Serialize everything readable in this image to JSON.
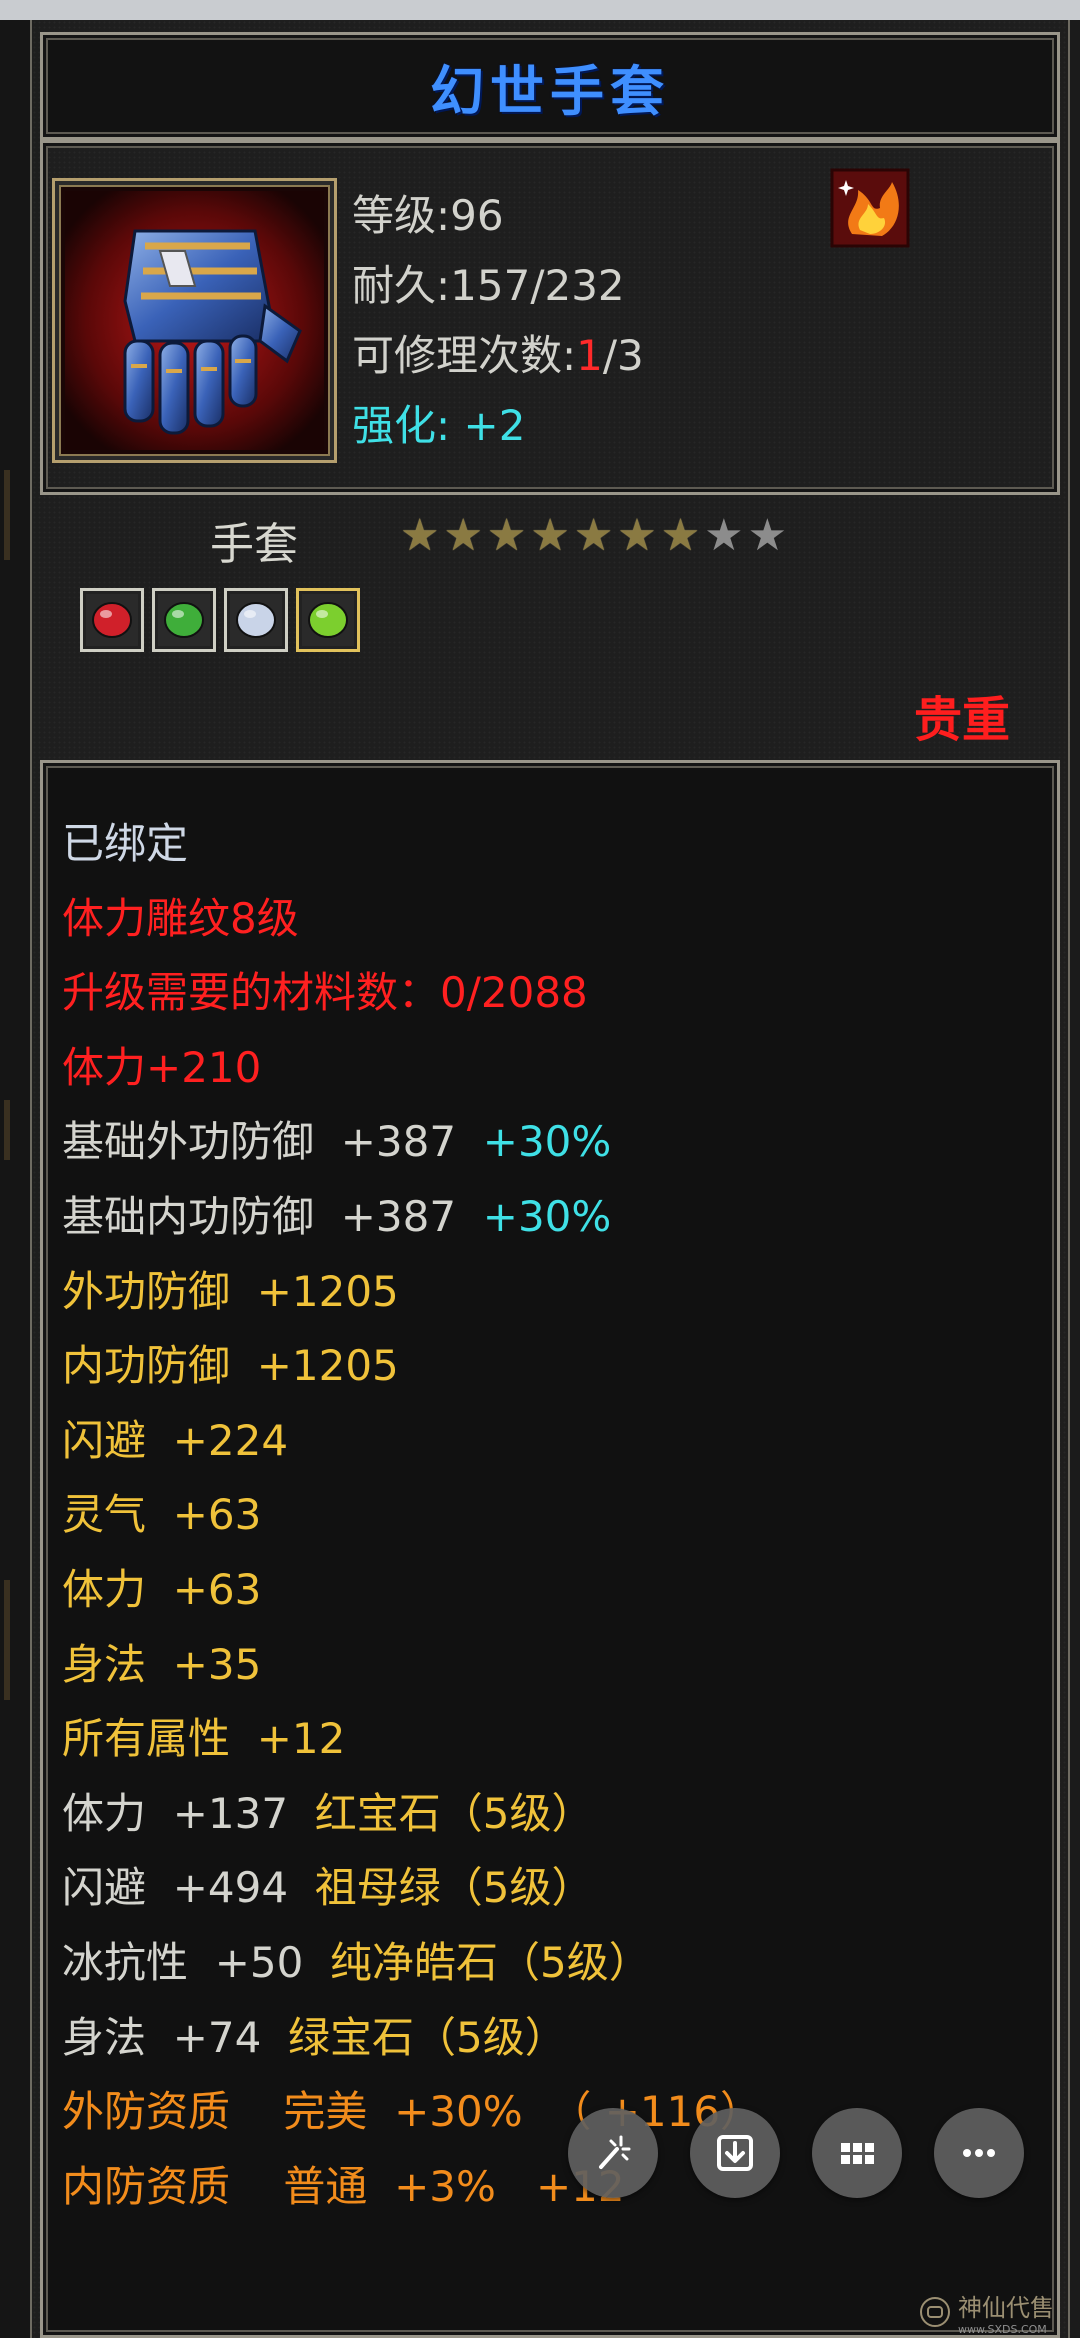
{
  "item": {
    "title": "幻世手套",
    "level_label": "等级",
    "level_value": "96",
    "durability_label": "耐久",
    "durability_value": "157/232",
    "repair_label": "可修理次数",
    "repair_used": "1",
    "repair_total": "/3",
    "enhance_label": "强化",
    "enhance_value": "+2",
    "type": "手套",
    "stars_total": 9,
    "stars_filled": 7,
    "rarity": "贵重"
  },
  "attributes": [
    {
      "segments": [
        {
          "text": "已绑定",
          "color": "white"
        }
      ]
    },
    {
      "segments": [
        {
          "text": "体力雕纹8级",
          "color": "red"
        }
      ]
    },
    {
      "segments": [
        {
          "text": "升级需要的材料数：0/2088",
          "color": "red"
        }
      ]
    },
    {
      "segments": [
        {
          "text": "体力+210",
          "color": "red"
        }
      ]
    },
    {
      "segments": [
        {
          "text": "基础外功防御  +387  ",
          "color": "grey"
        },
        {
          "text": "+30%",
          "color": "cyan"
        }
      ]
    },
    {
      "segments": [
        {
          "text": "基础内功防御  +387  ",
          "color": "grey"
        },
        {
          "text": "+30%",
          "color": "cyan"
        }
      ]
    },
    {
      "segments": [
        {
          "text": "外功防御  +1205",
          "color": "yellow"
        }
      ]
    },
    {
      "segments": [
        {
          "text": "内功防御  +1205",
          "color": "yellow"
        }
      ]
    },
    {
      "segments": [
        {
          "text": "闪避  +224",
          "color": "yellow"
        }
      ]
    },
    {
      "segments": [
        {
          "text": "灵气  +63",
          "color": "yellow"
        }
      ]
    },
    {
      "segments": [
        {
          "text": "体力  +63",
          "color": "yellow"
        }
      ]
    },
    {
      "segments": [
        {
          "text": "身法  +35",
          "color": "yellow"
        }
      ]
    },
    {
      "segments": [
        {
          "text": "所有属性  +12",
          "color": "yellow"
        }
      ]
    },
    {
      "segments": [
        {
          "text": "体力  +137  ",
          "color": "grey"
        },
        {
          "text": "红宝石（5级）",
          "color": "yellow"
        }
      ]
    },
    {
      "segments": [
        {
          "text": "闪避  +494  ",
          "color": "grey"
        },
        {
          "text": "祖母绿（5级）",
          "color": "yellow"
        }
      ]
    },
    {
      "segments": [
        {
          "text": "冰抗性  +50  ",
          "color": "grey"
        },
        {
          "text": "纯净皓石（5级）",
          "color": "yellow"
        }
      ]
    },
    {
      "segments": [
        {
          "text": "身法  +74  ",
          "color": "grey"
        },
        {
          "text": "绿宝石（5级）",
          "color": "yellow"
        }
      ]
    },
    {
      "segments": [
        {
          "text": "外防资质    完美  +30%  （ +116）",
          "color": "orange"
        }
      ]
    },
    {
      "segments": [
        {
          "text": "内防资质    普通  +3%   +12",
          "color": "orange"
        }
      ]
    }
  ],
  "gems": [
    {
      "name": "ruby-gem-icon",
      "color": "#d0202a"
    },
    {
      "name": "emerald-gem-icon",
      "color": "#3fae3a"
    },
    {
      "name": "diamond-gem-icon",
      "color": "#c9d4e8"
    },
    {
      "name": "green-gem-icon",
      "color": "#7ccf2e"
    }
  ],
  "actions": [
    {
      "name": "magic-wand-button",
      "icon": "magic-wand-icon"
    },
    {
      "name": "download-button",
      "icon": "download-icon"
    },
    {
      "name": "grid-button",
      "icon": "grid-icon"
    },
    {
      "name": "more-button",
      "icon": "more-icon"
    }
  ],
  "watermark": {
    "text": "神仙代售",
    "sub": "www.SXDS.COM"
  }
}
